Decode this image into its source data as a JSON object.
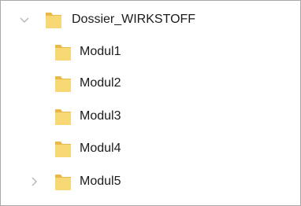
{
  "tree": {
    "root": {
      "label": "Dossier_WIRKSTOFF",
      "expanded": true,
      "icon": "folder-icon",
      "expander_icon": "chevron-down-icon"
    },
    "children": [
      {
        "label": "Modul1",
        "icon": "folder-icon",
        "has_children": false
      },
      {
        "label": "Modul2",
        "icon": "folder-icon",
        "has_children": false
      },
      {
        "label": "Modul3",
        "icon": "folder-icon",
        "has_children": false
      },
      {
        "label": "Modul4",
        "icon": "folder-icon",
        "has_children": false
      },
      {
        "label": "Modul5",
        "icon": "folder-icon",
        "has_children": true,
        "expander_icon": "chevron-right-icon"
      }
    ]
  },
  "colors": {
    "folder_front": "#f8d775",
    "folder_back": "#e8b84a",
    "chevron": "#b5b5b5",
    "text": "#1b1b1b",
    "border": "#a9a9a9"
  }
}
